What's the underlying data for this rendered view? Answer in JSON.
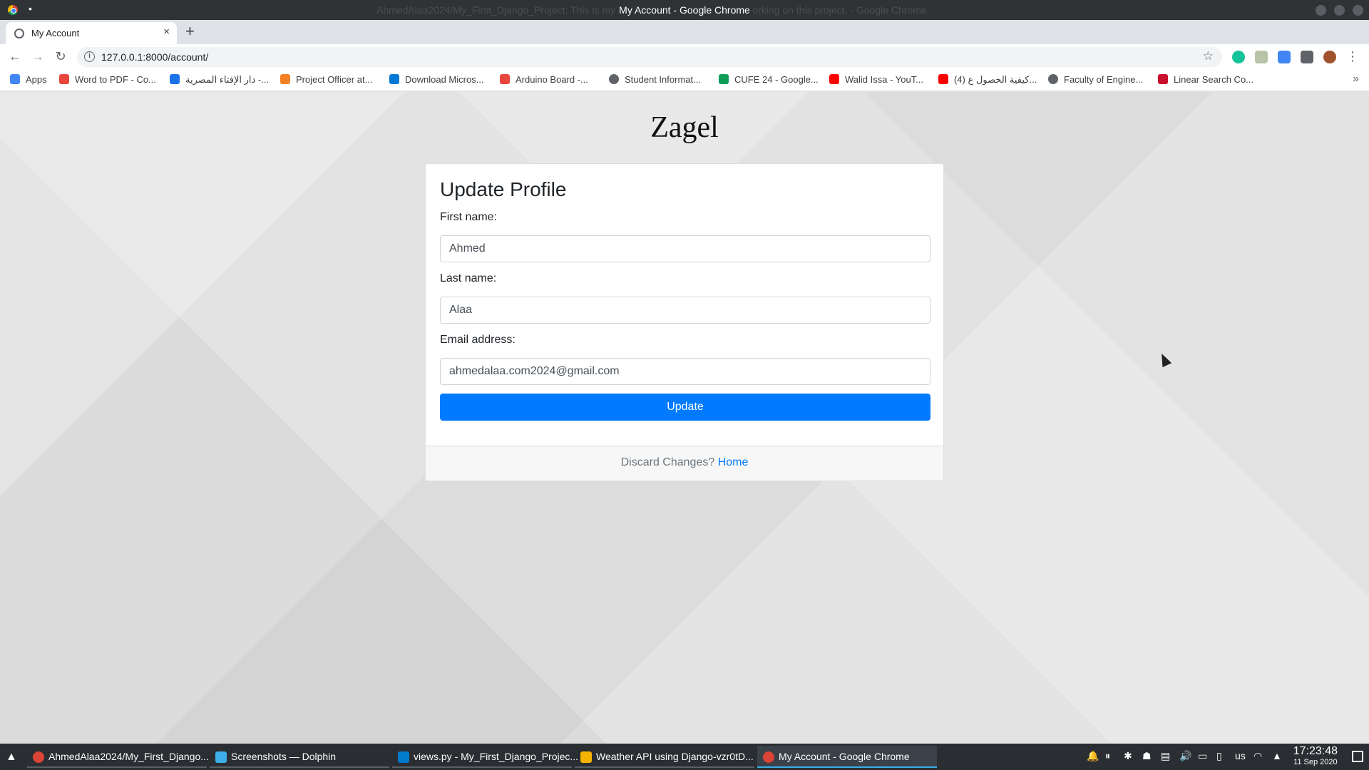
{
  "window": {
    "title": "My Account - Google Chrome",
    "ghost_title": "AhmedAlaa2024/My_First_Django_Project: This is my first project in Django during working on this project. - Google Chrome"
  },
  "tab": {
    "label": "My Account",
    "close": "×",
    "new_tab": "+"
  },
  "toolbar": {
    "back": "←",
    "forward": "→",
    "reload": "↻",
    "url": "127.0.0.1:8000/account/",
    "star": "☆",
    "menu": "⋮"
  },
  "bookmarks": {
    "items": [
      {
        "label": "Apps",
        "icon": "apps-grid-icon",
        "color": "#4285f4"
      },
      {
        "label": "Word to PDF - Co...",
        "icon": "word-to-pdf-icon",
        "color": "#e8453c"
      },
      {
        "label": "دار الإفتاء المصرية -...",
        "icon": "dar-al-iftaa-icon",
        "color": "#1a73e8"
      },
      {
        "label": "Project Officer at...",
        "icon": "stackoverflow-icon",
        "color": "#f48024"
      },
      {
        "label": "Download Micros...",
        "icon": "microsoft-icon",
        "color": "#0078d4"
      },
      {
        "label": "Arduino Board -...",
        "icon": "arduino-icon",
        "color": "#e8453c"
      },
      {
        "label": "Student Informat...",
        "icon": "globe-icon",
        "color": "#5f6368"
      },
      {
        "label": "CUFE 24 - Google...",
        "icon": "google-drive-icon",
        "color": "#0f9d58"
      },
      {
        "label": "Walid Issa - YouT...",
        "icon": "youtube-icon",
        "color": "#ff0000"
      },
      {
        "label": "(4) كيفية الحصول ع...",
        "icon": "youtube-icon",
        "color": "#ff0000"
      },
      {
        "label": "Faculty of Engine...",
        "icon": "globe-icon",
        "color": "#5f6368"
      },
      {
        "label": "Linear Search Co...",
        "icon": "edx-icon",
        "color": "#c8102e"
      }
    ],
    "more": "»"
  },
  "page": {
    "brand": "Zagel",
    "heading": "Update Profile",
    "fields": [
      {
        "label": "First name:",
        "value": "Ahmed"
      },
      {
        "label": "Last name:",
        "value": "Alaa"
      },
      {
        "label": "Email address:",
        "value": "ahmedalaa.com2024@gmail.com"
      }
    ],
    "submit": "Update",
    "footer_text": "Discard Changes?",
    "footer_link": "Home"
  },
  "taskbar": {
    "tasks": [
      {
        "label": "AhmedAlaa2024/My_First_Django...",
        "icon": "chrome-icon",
        "color": "#db4437"
      },
      {
        "label": "Screenshots — Dolphin",
        "icon": "dolphin-icon",
        "color": "#3daee9"
      },
      {
        "label": "views.py - My_First_Django_Projec...",
        "icon": "vscode-icon",
        "color": "#007acc"
      },
      {
        "label": "Weather API using Django-vzr0tD...",
        "icon": "video-player-icon",
        "color": "#f4b400"
      },
      {
        "label": "My Account - Google Chrome",
        "icon": "chrome-icon",
        "color": "#db4437"
      }
    ],
    "keyboard_layout": "us",
    "time": "17:23:48",
    "date": "11 Sep 2020"
  }
}
